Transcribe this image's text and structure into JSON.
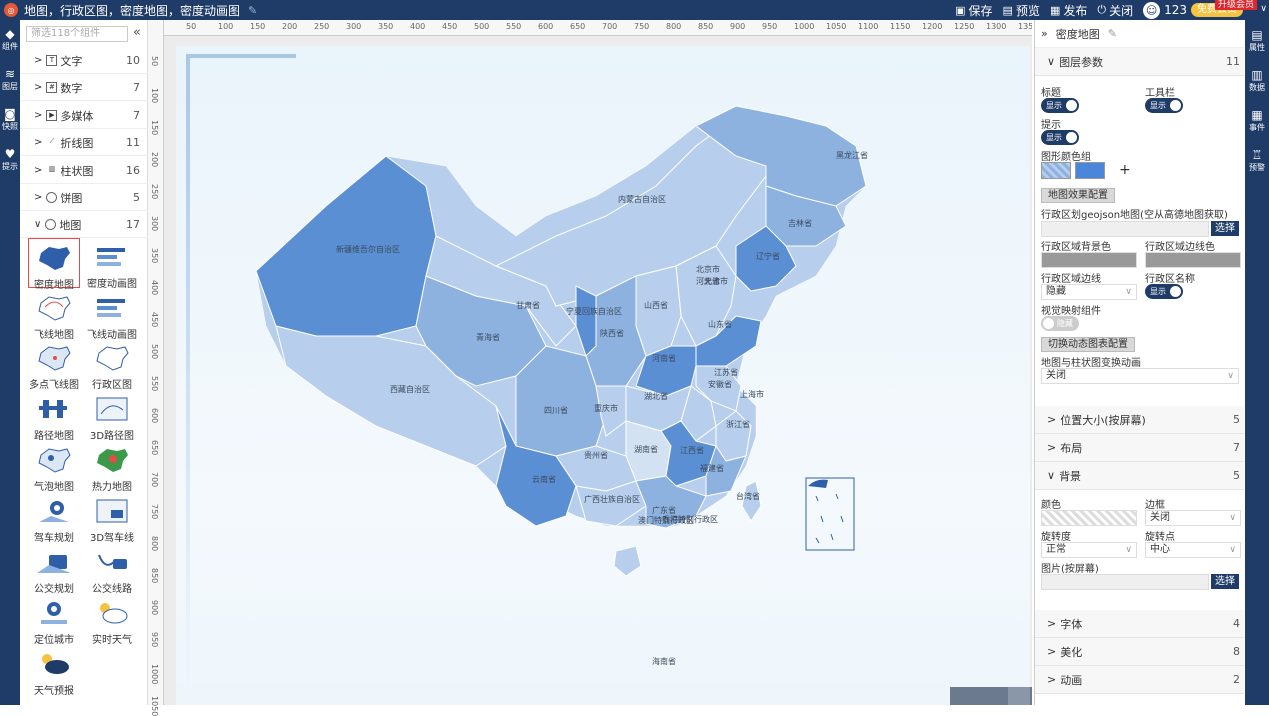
{
  "app": {
    "title": "地图，行政区图，密度地图，密度动画图",
    "actions": {
      "save": "保存",
      "preview": "预览",
      "publish": "发布",
      "close": "关闭"
    },
    "user": {
      "name": "123",
      "vip_label": "免费会员",
      "upgrade_label": "升级会员"
    }
  },
  "left_nav": [
    {
      "label": "组件",
      "icon": "cube-icon"
    },
    {
      "label": "图层",
      "icon": "layers-icon"
    },
    {
      "label": "快照",
      "icon": "camera-icon"
    },
    {
      "label": "提示",
      "icon": "pin-icon"
    }
  ],
  "components": {
    "search_placeholder": "筛选118个组件",
    "categories": [
      {
        "label": "文字",
        "count": "10",
        "expanded": false
      },
      {
        "label": "数字",
        "count": "7",
        "expanded": false
      },
      {
        "label": "多媒体",
        "count": "7",
        "expanded": false
      },
      {
        "label": "折线图",
        "count": "11",
        "expanded": false
      },
      {
        "label": "柱状图",
        "count": "16",
        "expanded": false
      },
      {
        "label": "饼图",
        "count": "5",
        "expanded": false
      },
      {
        "label": "地图",
        "count": "17",
        "expanded": true
      }
    ],
    "map_items": [
      "密度地图",
      "密度动画图",
      "飞线地图",
      "飞线动画图",
      "多点飞线图",
      "行政区图",
      "路径地图",
      "3D路径图",
      "气泡地图",
      "热力地图",
      "驾车规划",
      "3D驾车线",
      "公交规划",
      "公交线路",
      "定位城市",
      "实时天气",
      "天气预报"
    ]
  },
  "ruler": {
    "h_ticks": [
      "50",
      "100",
      "150",
      "200",
      "250",
      "300",
      "350",
      "400",
      "450",
      "500",
      "550",
      "600",
      "650",
      "700",
      "750",
      "800",
      "850",
      "900",
      "950",
      "1000",
      "1050",
      "1100",
      "1150",
      "1200",
      "1250",
      "1300",
      "1350"
    ],
    "v_ticks": [
      "50",
      "100",
      "150",
      "200",
      "250",
      "300",
      "350",
      "400",
      "450",
      "500",
      "550",
      "600",
      "650",
      "700",
      "750",
      "800",
      "850",
      "900",
      "950",
      "1000",
      "1050"
    ]
  },
  "map": {
    "provinces": [
      "黑龙江省",
      "吉林省",
      "辽宁省",
      "内蒙古自治区",
      "北京市",
      "河北省",
      "天津市",
      "新疆维吾尔自治区",
      "甘肃省",
      "宁夏回族自治区",
      "山西省",
      "山东省",
      "青海省",
      "陕西省",
      "河南省",
      "江苏省",
      "安徽省",
      "上海市",
      "西藏自治区",
      "四川省",
      "重庆市",
      "湖北省",
      "浙江省",
      "贵州省",
      "湖南省",
      "江西省",
      "福建省",
      "云南省",
      "广西壮族自治区",
      "广东省",
      "台湾省",
      "香港特别行政区",
      "澳门特别行政区",
      "海南省"
    ],
    "colors": {
      "dark": "#5b8fd4",
      "mid": "#8db2e0",
      "light": "#b7cfec",
      "pale": "#d3e2f3"
    }
  },
  "props": {
    "component_name": "密度地图",
    "layer_params": {
      "label": "图层参数",
      "count": "11"
    },
    "title_label": "标题",
    "toolbar_label": "工具栏",
    "hint_label": "提示",
    "show_label": "显示",
    "hide_label": "隐藏",
    "color_group_label": "图形颜色组",
    "add_symbol": "+",
    "map_effect_btn": "地图效果配置",
    "geojson_label": "行政区划geojson地图(空从高德地图获取)",
    "select_btn": "选择",
    "region_bg_label": "行政区域背景色",
    "region_border_color_label": "行政区域边线色",
    "region_border_label": "行政区域边线",
    "region_border_value": "隐藏",
    "region_name_label": "行政区名称",
    "visual_map_label": "视觉映射组件",
    "switch_dynamic_btn": "切换动态图表配置",
    "map_bar_anim_label": "地图与柱状图变换动画",
    "map_bar_anim_value": "关闭",
    "sections": [
      {
        "label": "位置大小(按屏幕)",
        "count": "5"
      },
      {
        "label": "布局",
        "count": "7"
      },
      {
        "label": "背景",
        "count": "5"
      }
    ],
    "bg": {
      "color_label": "颜色",
      "border_label": "边框",
      "border_value": "关闭",
      "rotate_label": "旋转度",
      "rotate_value": "正常",
      "rotate_point_label": "旋转点",
      "rotate_point_value": "中心",
      "image_label": "图片(按屏幕)"
    },
    "bottom_sections": [
      {
        "label": "字体",
        "count": "4"
      },
      {
        "label": "美化",
        "count": "8"
      },
      {
        "label": "动画",
        "count": "2"
      }
    ]
  },
  "right_nav": [
    {
      "label": "属性",
      "icon": "properties-icon"
    },
    {
      "label": "数据",
      "icon": "database-icon"
    },
    {
      "label": "事件",
      "icon": "event-icon"
    },
    {
      "label": "预警",
      "icon": "alarm-icon"
    }
  ]
}
